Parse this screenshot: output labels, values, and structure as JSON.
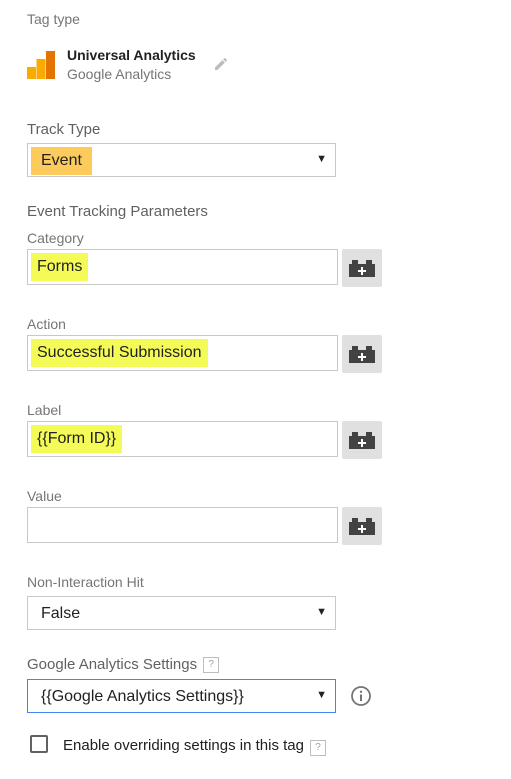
{
  "tag_type": {
    "section_label": "Tag type",
    "name": "Universal Analytics",
    "provider": "Google Analytics"
  },
  "track_type": {
    "label": "Track Type",
    "value": "Event"
  },
  "event_params": {
    "heading": "Event Tracking Parameters",
    "category": {
      "label": "Category",
      "value": "Forms"
    },
    "action": {
      "label": "Action",
      "value": "Successful Submission"
    },
    "label_field": {
      "label": "Label",
      "value": "{{Form ID}}"
    },
    "value_field": {
      "label": "Value",
      "value": ""
    }
  },
  "non_interaction": {
    "label": "Non-Interaction Hit",
    "value": "False"
  },
  "ga_settings": {
    "label": "Google Analytics Settings",
    "help": "?",
    "value": "{{Google Analytics Settings}}"
  },
  "override": {
    "label": "Enable overriding settings in this tag",
    "help": "?",
    "checked": false
  },
  "colors": {
    "highlight_yellow": "#f4fb57",
    "highlight_orange": "#fdcb5c",
    "logo_orange": "#f9ab00",
    "logo_dark_orange": "#e37400",
    "focus_blue": "#4285f4"
  },
  "icons": [
    "google-analytics-logo",
    "pencil-icon",
    "variable-picker-icon",
    "info-icon",
    "help-icon"
  ]
}
